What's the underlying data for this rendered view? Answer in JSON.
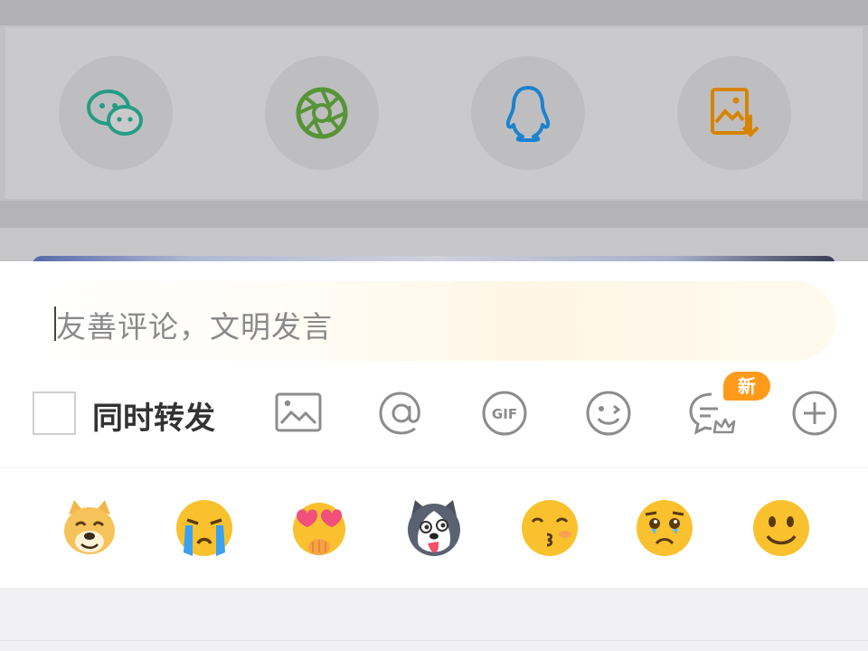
{
  "share_sheet": {
    "items": [
      {
        "icon": "wechat-icon",
        "color": "#1aad19"
      },
      {
        "icon": "moments-icon",
        "color": "#4caf50"
      },
      {
        "icon": "qq-icon",
        "color": "#1296db"
      },
      {
        "icon": "save-image-icon",
        "color": "#e08a00"
      }
    ]
  },
  "comment": {
    "placeholder": "友善评论，文明发言",
    "repost_label": "同时转发",
    "repost_checked": false,
    "new_badge": "新",
    "tools": [
      "image-icon",
      "mention-icon",
      "gif-icon",
      "emoji-icon",
      "comment-style-icon",
      "add-icon"
    ],
    "emojis": [
      "doge-emoji",
      "crying-emoji",
      "heart-eyes-emoji",
      "husky-emoji",
      "kiss-emoji",
      "sad-teary-emoji",
      "smile-emoji"
    ]
  },
  "colors": {
    "accent": "#ff9a1a",
    "icon_gray": "#8a8a8a"
  }
}
